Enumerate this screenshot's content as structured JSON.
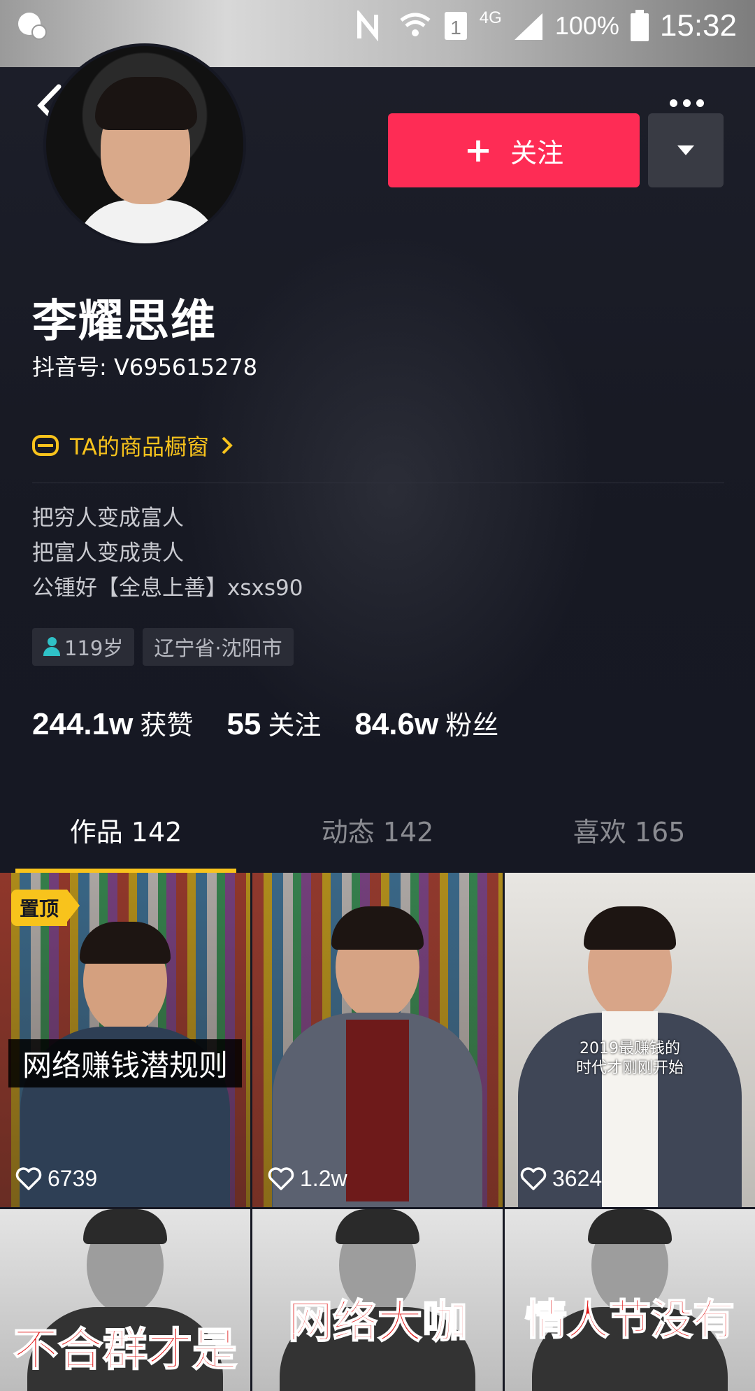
{
  "status_bar": {
    "battery_percent": "100%",
    "time": "15:32",
    "network": "4G"
  },
  "profile": {
    "follow_label": "关注",
    "name": "李耀思维",
    "douyin_id": "抖音号: V695615278",
    "shop_link": "TA的商品橱窗",
    "bio": [
      "把穷人变成富人",
      "把富人变成贵人",
      "公锺好【全息上善】xsxs90"
    ],
    "tags": [
      "119岁",
      "辽宁省·沈阳市"
    ],
    "stats": [
      {
        "num": "244.1w",
        "label": "获赞"
      },
      {
        "num": "55",
        "label": "关注"
      },
      {
        "num": "84.6w",
        "label": "粉丝"
      }
    ]
  },
  "tabs": [
    {
      "label": "作品 142",
      "active": true
    },
    {
      "label": "动态 142",
      "active": false
    },
    {
      "label": "喜欢 165",
      "active": false
    }
  ],
  "videos": [
    {
      "pinned_label": "置顶",
      "caption": "网络赚钱潜规则",
      "likes": "6739"
    },
    {
      "caption": "",
      "likes": "1.2w"
    },
    {
      "caption": "2019最赚钱的\n时代才刚刚开始",
      "likes": "3624"
    },
    {
      "caption": "不合群才是",
      "likes": ""
    },
    {
      "caption": "网络大咖",
      "likes": ""
    },
    {
      "caption": "情人节没有",
      "likes": ""
    }
  ],
  "colors": {
    "follow_button": "#fe2c55",
    "accent_yellow": "#f8c31c",
    "background": "#161823"
  }
}
